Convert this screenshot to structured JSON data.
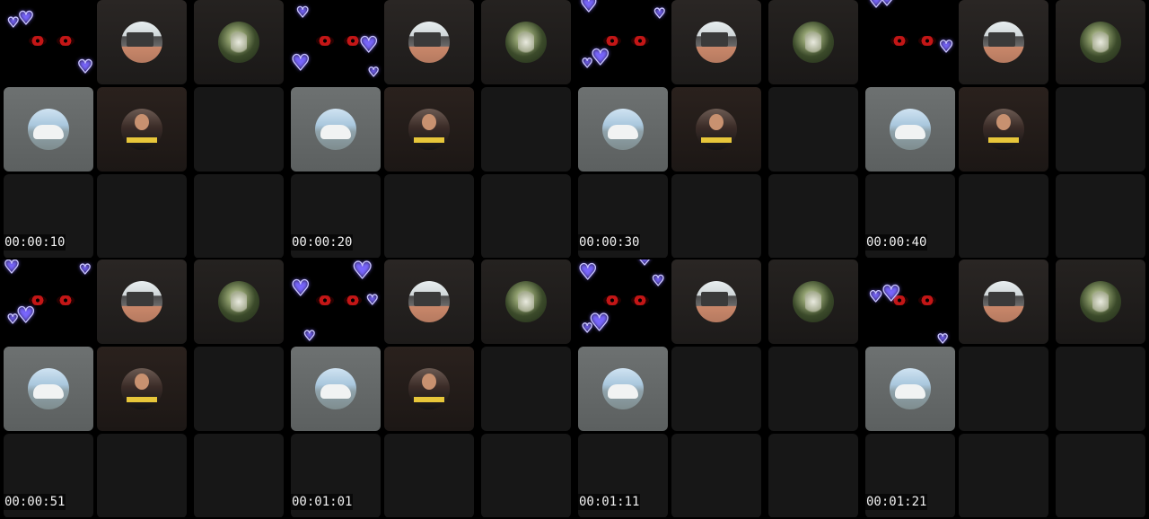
{
  "timestamps": [
    "00:00:10",
    "00:00:20",
    "00:00:30",
    "00:00:40",
    "00:00:51",
    "00:01:01",
    "00:01:11",
    "00:01:21"
  ],
  "icons": {
    "eyes": "red-eyes-icon",
    "heart": "heart-icon"
  },
  "colors": {
    "background": "#000000",
    "tile": "#171717",
    "grey_tile": "#646868",
    "eye_red": "#c31616",
    "heart_outline": "#c9c4ff"
  }
}
